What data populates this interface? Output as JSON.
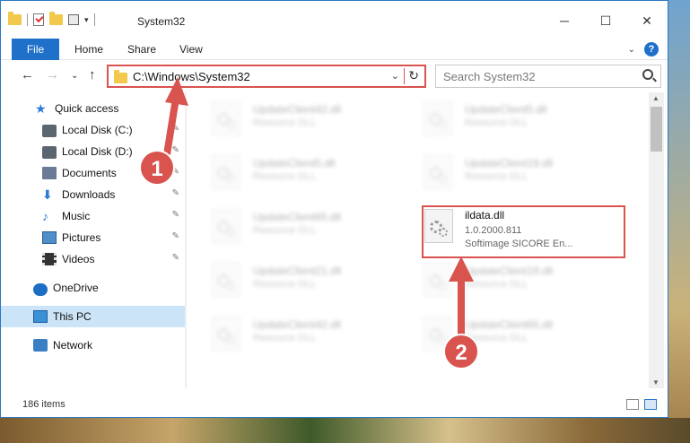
{
  "window": {
    "title": "System32",
    "controls": {
      "minimize": "─",
      "maximize": "☐",
      "close": "✕"
    }
  },
  "ribbon": {
    "file_label": "File",
    "tabs": [
      "Home",
      "Share",
      "View"
    ],
    "collapse_glyph": "⌄",
    "help_glyph": "?"
  },
  "nav": {
    "back": "←",
    "forward": "→",
    "recent": "⌄",
    "up": "↑"
  },
  "address": {
    "path": "C:\\Windows\\System32",
    "dropdown_glyph": "⌄",
    "refresh_glyph": "↻"
  },
  "search": {
    "placeholder": "Search System32"
  },
  "sidebar": {
    "items": [
      {
        "label": "Quick access",
        "icon": "star-icon",
        "pinned": false
      },
      {
        "label": "Local Disk (C:)",
        "icon": "drive-icon",
        "pinned": true
      },
      {
        "label": "Local Disk (D:)",
        "icon": "drive-icon",
        "pinned": true
      },
      {
        "label": "Documents",
        "icon": "documents-icon",
        "pinned": true
      },
      {
        "label": "Downloads",
        "icon": "download-icon",
        "pinned": true
      },
      {
        "label": "Music",
        "icon": "music-icon",
        "pinned": true
      },
      {
        "label": "Pictures",
        "icon": "pictures-icon",
        "pinned": true
      },
      {
        "label": "Videos",
        "icon": "videos-icon",
        "pinned": true
      },
      {
        "label": "OneDrive",
        "icon": "cloud-icon",
        "pinned": false
      },
      {
        "label": "This PC",
        "icon": "pc-icon",
        "pinned": false
      },
      {
        "label": "Network",
        "icon": "network-icon",
        "pinned": false
      }
    ],
    "pin_glyph": "📌"
  },
  "files": [
    {
      "name": "UpdateClient42.dll",
      "type": "Resource DLL"
    },
    {
      "name": "UpdateClient5.dll",
      "type": "Resource DLL"
    },
    {
      "name": "UpdateClient5.dll",
      "type": "Resource DLL"
    },
    {
      "name": "UpdateClient19.dll",
      "type": "Resource DLL"
    },
    {
      "name": "UpdateClient65.dll",
      "type": "Resource DLL"
    },
    {
      "name": "UpdateClient21.dll",
      "type": "Resource DLL"
    },
    {
      "name": "UpdateClient19.dll",
      "type": "Resource DLL"
    },
    {
      "name": "UpdateClient42.dll",
      "type": "Resource DLL"
    },
    {
      "name": "UpdateClient65.dll",
      "type": "Resource DLL"
    }
  ],
  "selected_file": {
    "name": "ildata.dll",
    "version": "1.0.2000.811",
    "description": "Softimage SICORE En..."
  },
  "status": {
    "item_count": "186 items"
  },
  "annotations": {
    "step1": "1",
    "step2": "2",
    "color": "#d9534f"
  }
}
